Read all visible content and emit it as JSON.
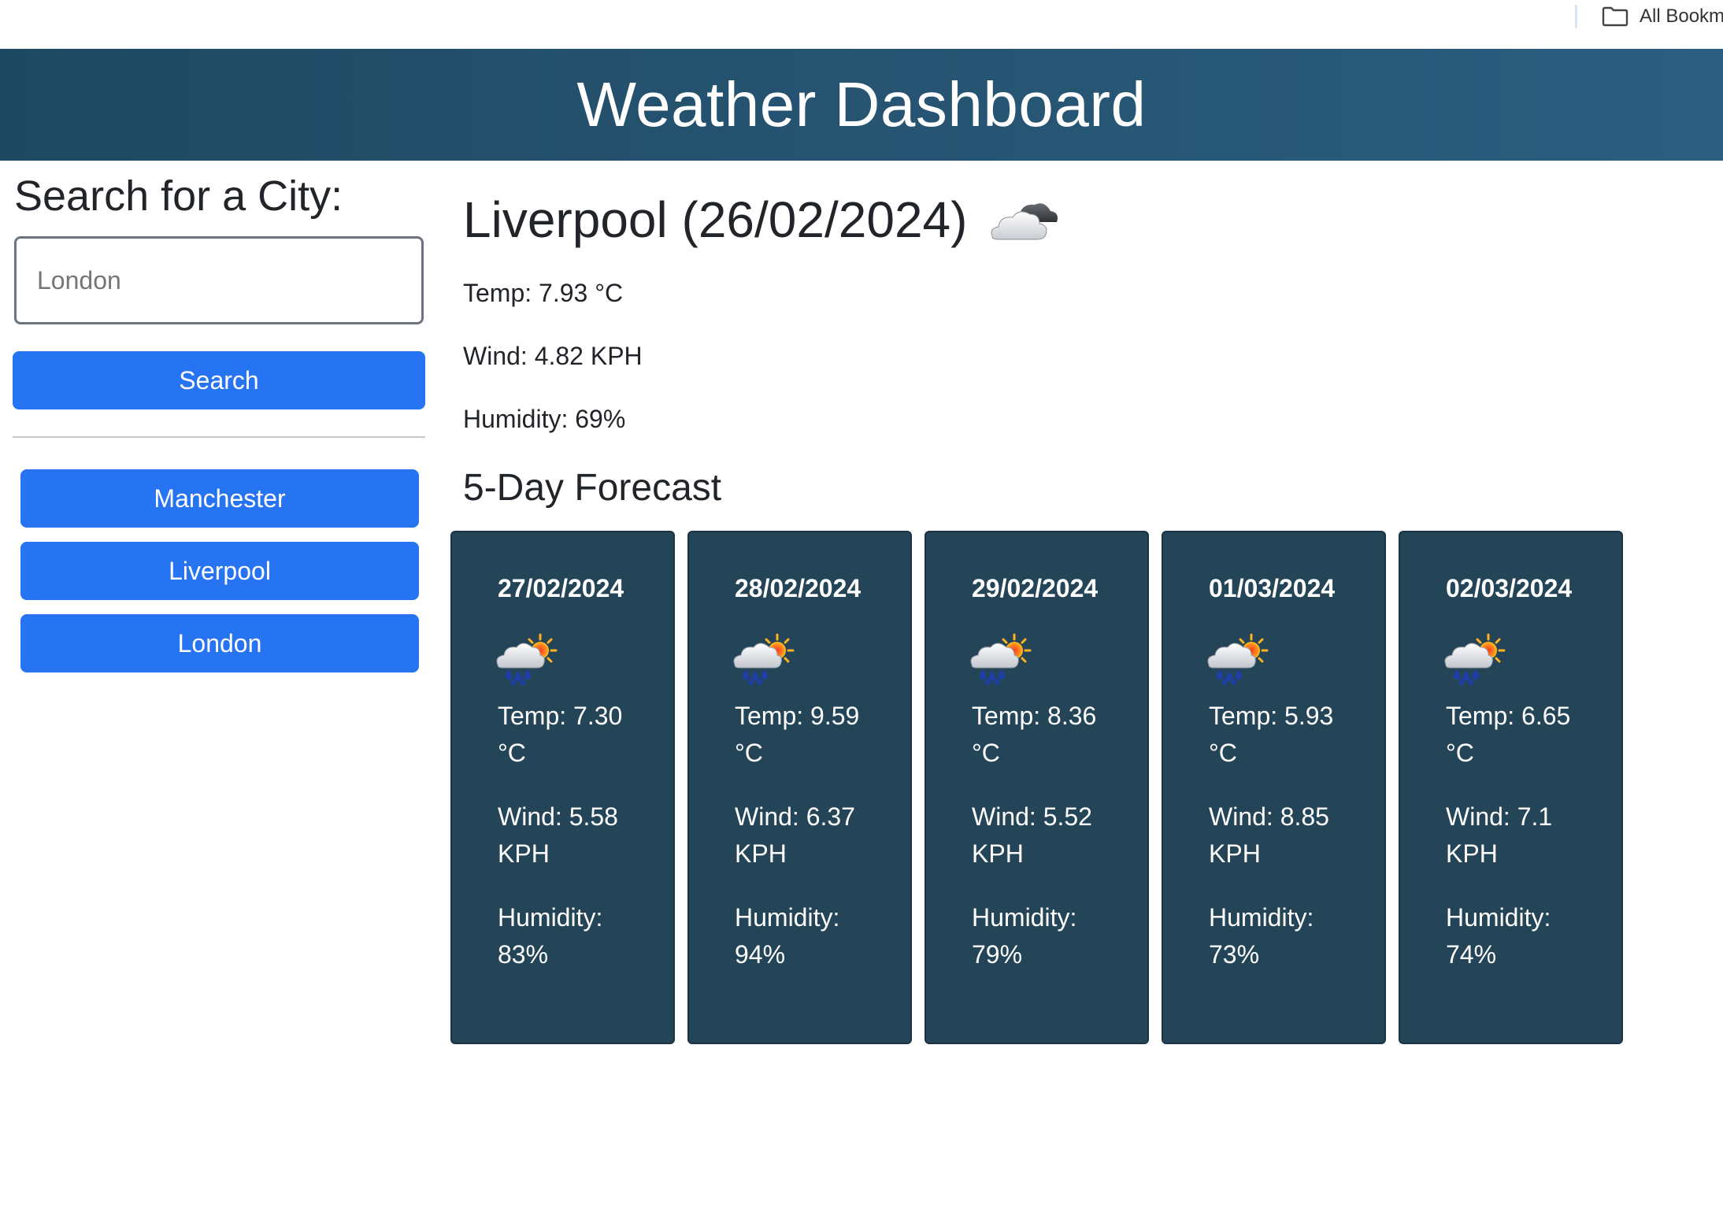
{
  "browser": {
    "bookmarks_label": "All Bookm"
  },
  "header": {
    "title": "Weather Dashboard"
  },
  "sidebar": {
    "heading": "Search for a City:",
    "search_placeholder": "London",
    "search_button": "Search",
    "history": [
      {
        "label": "Manchester"
      },
      {
        "label": "Liverpool"
      },
      {
        "label": "London"
      }
    ]
  },
  "current": {
    "title": "Liverpool (26/02/2024)",
    "icon": "cloud-icon",
    "temp": "Temp: 7.93 °C",
    "wind": "Wind: 4.82 KPH",
    "humidity": "Humidity: 69%"
  },
  "forecast": {
    "title": "5-Day Forecast",
    "days": [
      {
        "date": "27/02/2024",
        "icon": "rain-sun-cloud-icon",
        "temp": "Temp: 7.30 °C",
        "wind": "Wind: 5.58 KPH",
        "humidity": "Humidity: 83%"
      },
      {
        "date": "28/02/2024",
        "icon": "rain-sun-cloud-icon",
        "temp": "Temp: 9.59 °C",
        "wind": "Wind: 6.37 KPH",
        "humidity": "Humidity: 94%"
      },
      {
        "date": "29/02/2024",
        "icon": "rain-sun-cloud-icon",
        "temp": "Temp: 8.36 °C",
        "wind": "Wind: 5.52 KPH",
        "humidity": "Humidity: 79%"
      },
      {
        "date": "01/03/2024",
        "icon": "rain-sun-cloud-icon",
        "temp": "Temp: 5.93 °C",
        "wind": "Wind: 8.85 KPH",
        "humidity": "Humidity: 73%"
      },
      {
        "date": "02/03/2024",
        "icon": "rain-sun-cloud-icon",
        "temp": "Temp: 6.65 °C",
        "wind": "Wind: 7.1 KPH",
        "humidity": "Humidity: 74%"
      }
    ]
  },
  "colors": {
    "header_bg": "#244f6c",
    "button_bg": "#2674f2",
    "card_bg": "#244558"
  }
}
